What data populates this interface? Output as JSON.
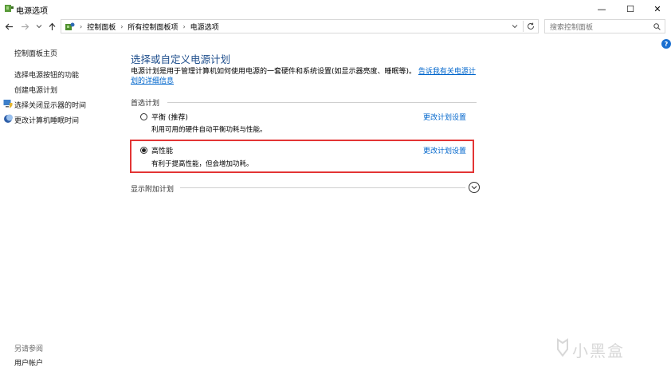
{
  "window": {
    "title": "电源选项",
    "minimize": "—",
    "maximize": "☐",
    "close": "✕"
  },
  "addressbar": {
    "crumbs": [
      "控制面板",
      "所有控制面板项",
      "电源选项"
    ],
    "separator": "›",
    "search_placeholder": "搜索控制面板"
  },
  "sidebar": {
    "home": "控制面板主页",
    "items": [
      "选择电源按钮的功能",
      "创建电源计划",
      "选择关闭显示器的时间",
      "更改计算机睡眠时间"
    ],
    "see_also_title": "另请参阅",
    "see_also_items": [
      "用户帐户"
    ]
  },
  "main": {
    "heading": "选择或自定义电源计划",
    "description": "电源计划是用于管理计算机如何使用电源的一套硬件和系统设置(如显示器亮度、睡眠等)。",
    "description_link": "告诉我有关电源计划的详细信息",
    "preferred_label": "首选计划",
    "plans": [
      {
        "name": "平衡 (推荐)",
        "desc": "利用可用的硬件自动平衡功耗与性能。",
        "link": "更改计划设置",
        "selected": false
      },
      {
        "name": "高性能",
        "desc": "有利于提高性能，但会增加功耗。",
        "link": "更改计划设置",
        "selected": true
      }
    ],
    "additional_label": "显示附加计划"
  },
  "watermark": "小黑盒",
  "colors": {
    "highlight": "#e33535",
    "link": "#0066cc",
    "heading": "#1e4e8c"
  }
}
